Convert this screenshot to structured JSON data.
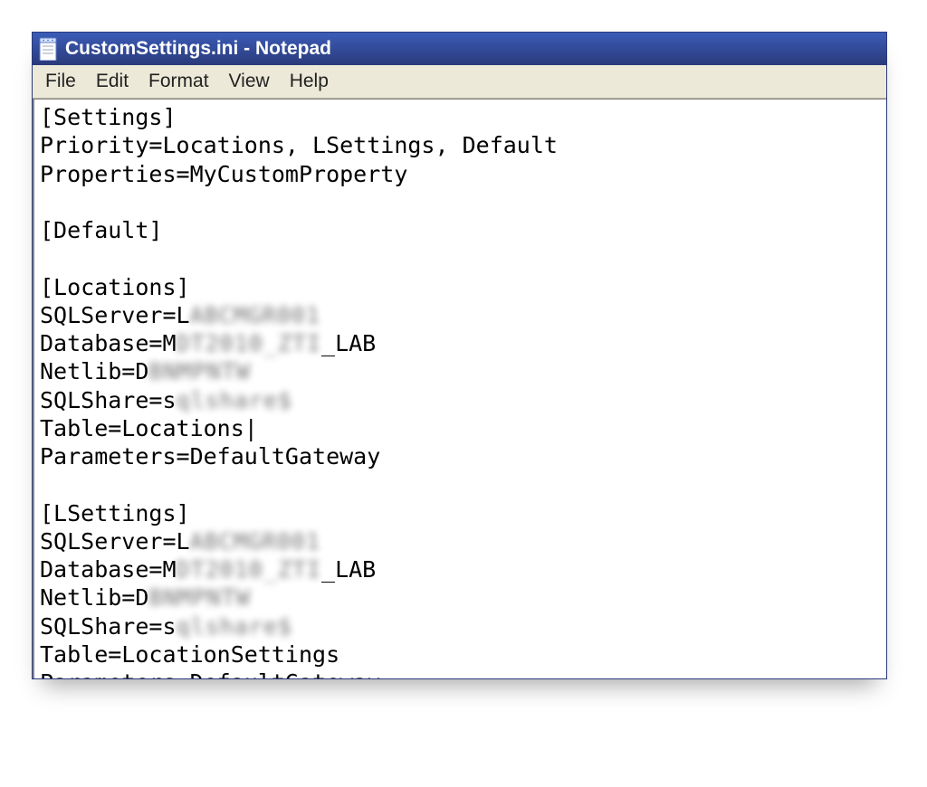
{
  "window": {
    "title": "CustomSettings.ini - Notepad"
  },
  "menubar": {
    "items": [
      "File",
      "Edit",
      "Format",
      "View",
      "Help"
    ]
  },
  "document": {
    "lines": [
      {
        "text": "[Settings]"
      },
      {
        "text": "Priority=Locations, LSettings, Default"
      },
      {
        "text": "Properties=MyCustomProperty"
      },
      {
        "text": ""
      },
      {
        "text": "[Default]"
      },
      {
        "text": ""
      },
      {
        "text": "[Locations]"
      },
      {
        "prefix": "SQLServer=L",
        "redacted": "ABCMGR001"
      },
      {
        "prefix": "Database=M",
        "redacted": "DT2010_ZTI",
        "suffix": "_LAB"
      },
      {
        "prefix": "Netlib=D",
        "redacted": "BNMPNTW"
      },
      {
        "prefix": "SQLShare=s",
        "redacted": "qlshare$",
        "suffix": ""
      },
      {
        "text": "Table=Locations|"
      },
      {
        "text": "Parameters=DefaultGateway"
      },
      {
        "text": ""
      },
      {
        "text": "[LSettings]"
      },
      {
        "prefix": "SQLServer=L",
        "redacted": "ABCMGR001"
      },
      {
        "prefix": "Database=M",
        "redacted": "DT2010_ZTI",
        "suffix": "_LAB"
      },
      {
        "prefix": "Netlib=D",
        "redacted": "BNMPNTW"
      },
      {
        "prefix": "SQLShare=s",
        "redacted": "qlshare$",
        "suffix": ""
      },
      {
        "text": "Table=LocationSettings"
      },
      {
        "text": "Parameters=DefaultGateway"
      }
    ]
  }
}
